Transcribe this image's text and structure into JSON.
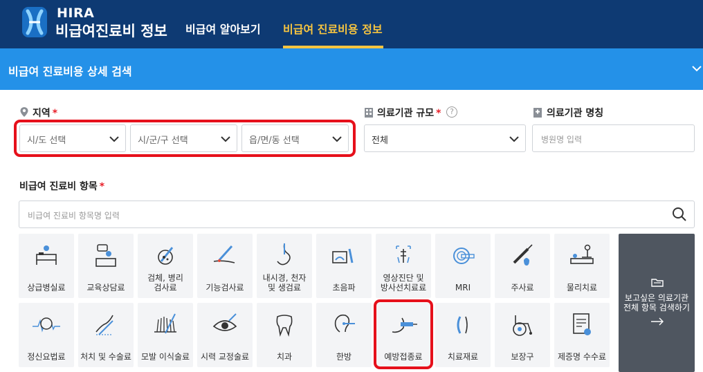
{
  "header": {
    "logo_line1": "HIRA",
    "logo_line2": "비급여진료비 정보",
    "nav": [
      "비급여 알아보기",
      "비급여 진료비용 정보"
    ],
    "active_nav_index": 1,
    "colors": {
      "bg": "#0e3a73",
      "accent": "#f6c440"
    }
  },
  "search_panel": {
    "title": "비급여 진료비용 상세 검색",
    "bg_color": "#2491e8"
  },
  "region": {
    "label": "지역",
    "required_mark": "*",
    "icon": "location-pin-icon",
    "selects": [
      "시/도 선택",
      "시/군/구 선택",
      "읍/면/동 선택"
    ]
  },
  "scale": {
    "label": "의료기관 규모",
    "required_mark": "*",
    "help": "?",
    "icon": "building-icon",
    "value": "전체"
  },
  "hospital_name": {
    "label": "의료기관 명칭",
    "icon": "hospital-icon",
    "placeholder": "병원명 입력"
  },
  "item": {
    "label": "비급여 진료비 항목",
    "required_mark": "*",
    "placeholder": "비급여 진료비 항목명 입력"
  },
  "categories_row1": [
    {
      "label": "상급병실료",
      "icon": "hospital-bed-icon"
    },
    {
      "label": "교육상담료",
      "icon": "counseling-desk-icon"
    },
    {
      "label": "검체, 병리\n검사료",
      "icon": "microscope-icon"
    },
    {
      "label": "기능검사료",
      "icon": "arm-test-icon"
    },
    {
      "label": "내시경, 천자\n및 생검료",
      "icon": "stomach-endoscope-icon"
    },
    {
      "label": "초음파",
      "icon": "ultrasound-icon"
    },
    {
      "label": "영상진단 및\n방사선치료료",
      "icon": "xray-icon"
    },
    {
      "label": "MRI",
      "icon": "mri-scanner-icon"
    },
    {
      "label": "주사료",
      "icon": "syringe-icon"
    },
    {
      "label": "물리치료",
      "icon": "physical-therapy-icon"
    }
  ],
  "categories_row2": [
    {
      "label": "정신요법료",
      "icon": "brain-wave-icon"
    },
    {
      "label": "처치 및 수술료",
      "icon": "scalpel-hand-icon"
    },
    {
      "label": "모발 이식술료",
      "icon": "hair-transplant-icon"
    },
    {
      "label": "시력 교정술료",
      "icon": "eye-laser-icon"
    },
    {
      "label": "치과",
      "icon": "tooth-icon"
    },
    {
      "label": "한방",
      "icon": "ear-acupuncture-icon"
    },
    {
      "label": "예방접종료",
      "icon": "vaccine-arm-icon"
    },
    {
      "label": "치료재료",
      "icon": "lens-material-icon"
    },
    {
      "label": "보장구",
      "icon": "wheelchair-icon"
    },
    {
      "label": "제증명 수수료",
      "icon": "certificate-icon"
    }
  ],
  "all_items_tile": {
    "label": "보고싶은 의료기관\n전체 항목 검색하기",
    "icon": "folder-icon",
    "arrow": "arrow-right-icon"
  },
  "highlight_color": "#e6101b"
}
